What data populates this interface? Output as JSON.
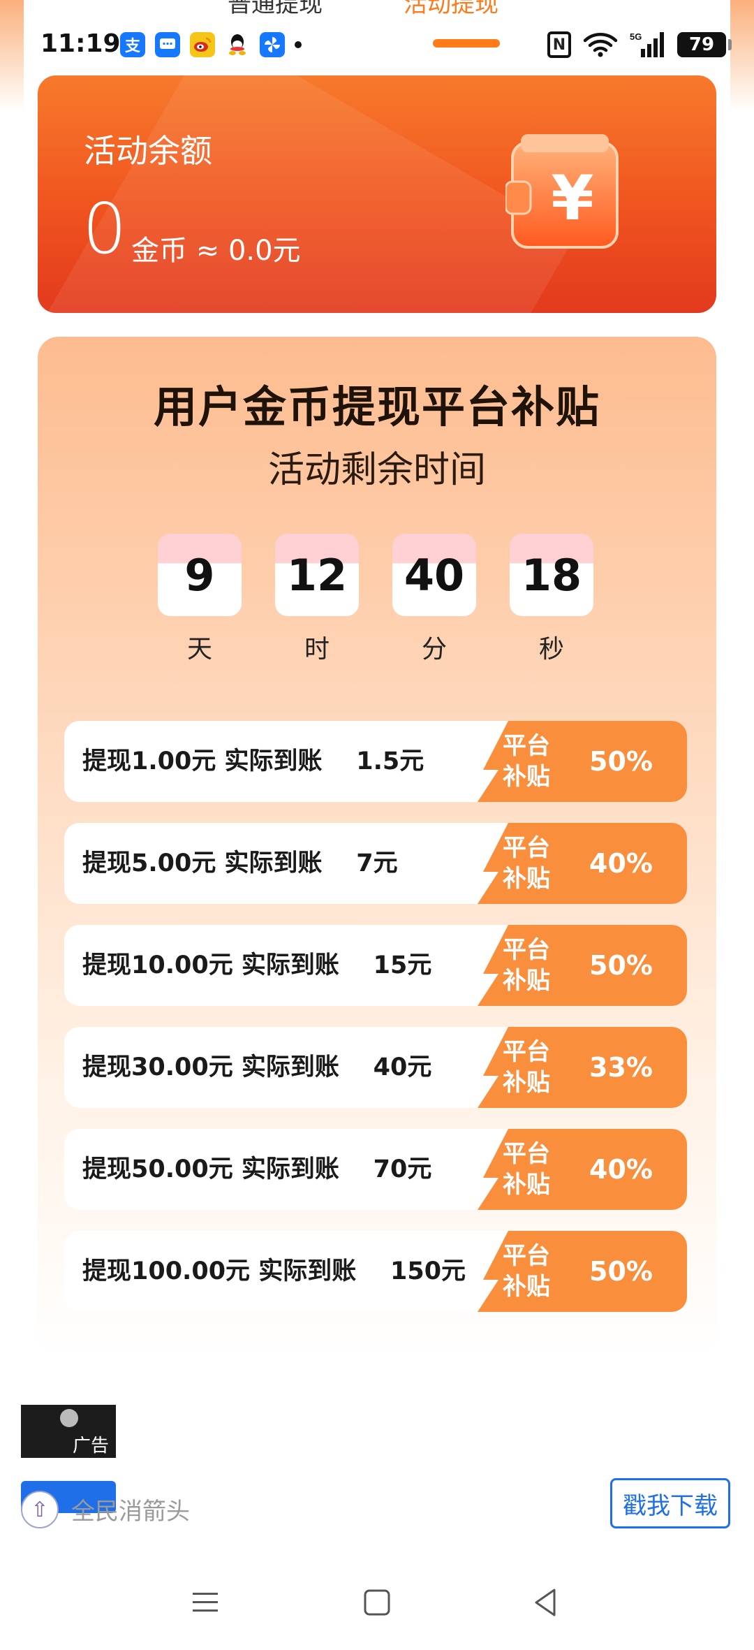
{
  "tabs": {
    "normal": "普通提现",
    "active": "活动提现"
  },
  "status_bar": {
    "time": "11:19",
    "notification_icons": [
      "alipay-icon",
      "message-icon",
      "weibo-icon",
      "qq-icon",
      "pinwheel-icon"
    ],
    "nfc": "N",
    "battery": "79",
    "network": "5G"
  },
  "balance": {
    "title": "活动余额",
    "amount": "0",
    "suffix": "金币 ≈ 0.0元",
    "wallet_symbol": "¥"
  },
  "promo": {
    "title": "用户金币提现平台补贴",
    "subtitle": "活动剩余时间",
    "countdown": [
      {
        "value": "9",
        "unit": "天"
      },
      {
        "value": "12",
        "unit": "时"
      },
      {
        "value": "40",
        "unit": "分"
      },
      {
        "value": "18",
        "unit": "秒"
      }
    ],
    "badge_label": "平台补贴",
    "offers": [
      {
        "text": "提现1.00元 实际到账    1.5元",
        "percent": "50%"
      },
      {
        "text": "提现5.00元 实际到账    7元",
        "percent": "40%"
      },
      {
        "text": "提现10.00元 实际到账    15元",
        "percent": "50%"
      },
      {
        "text": "提现30.00元 实际到账    40元",
        "percent": "33%"
      },
      {
        "text": "提现50.00元 实际到账    70元",
        "percent": "40%"
      },
      {
        "text": "提现100.00元 实际到账    150元",
        "percent": "50%"
      }
    ]
  },
  "ad": {
    "badge": "广告",
    "app_name": "全民消箭头",
    "button": "戳我下载"
  },
  "colors": {
    "accent": "#ff7a1a",
    "card_red": "#e23a1e",
    "badge_orange": "#f98e3c",
    "download_blue": "#1e6fe8"
  }
}
